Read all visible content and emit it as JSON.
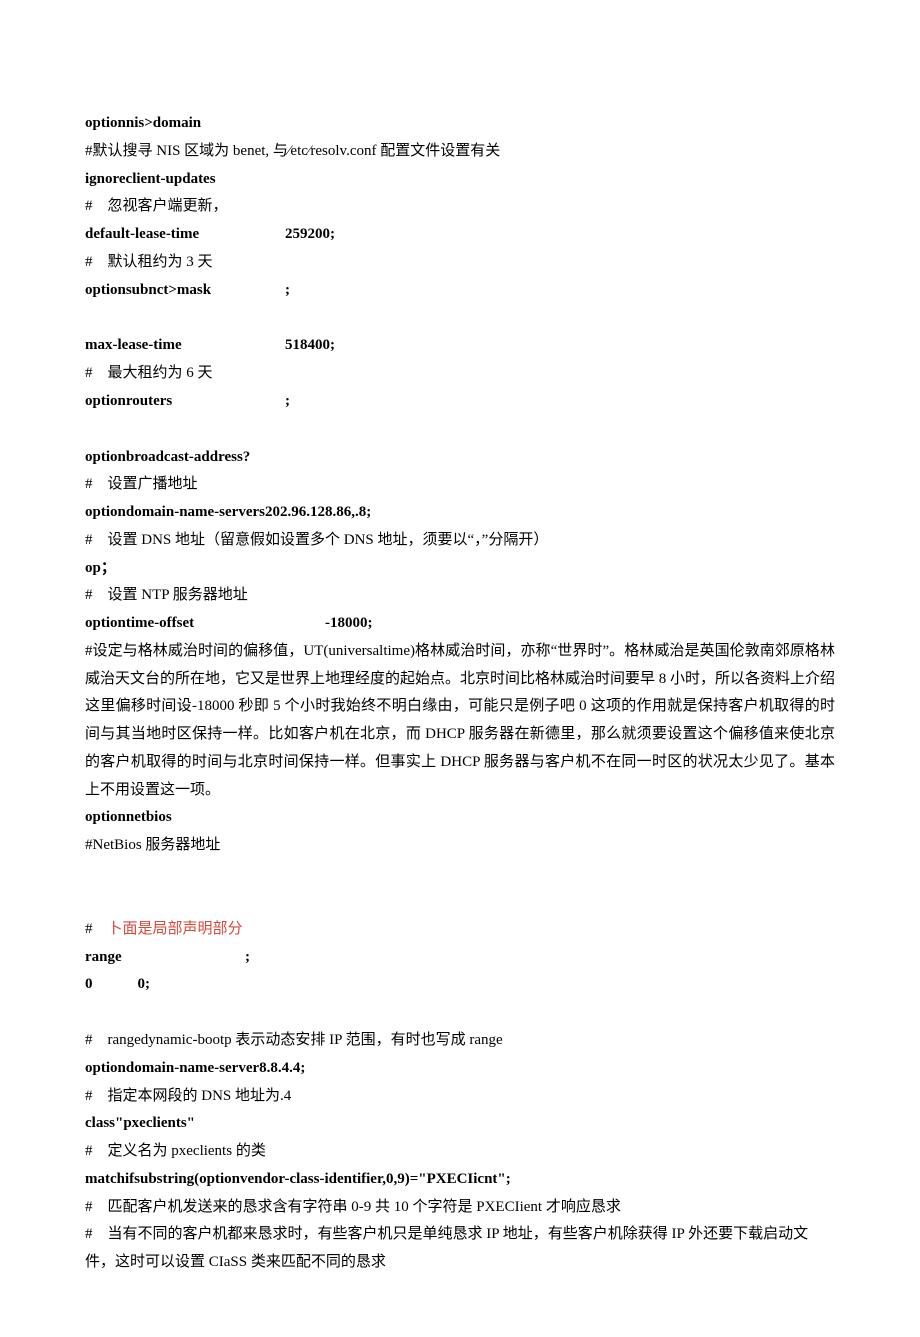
{
  "l01": "optionnis>domain",
  "l02": "#默认搜寻 NIS 区域为 benet, 与⁄etc⁄resolv.conf 配置文件设置有关",
  "l03": "ignoreclient-updates",
  "l04": "#　忽视客户端更新，",
  "l05_left": "default-lease-time",
  "l05_right": "259200;",
  "l06": "#　默认租约为 3 天",
  "l07_left": "optionsubnct>mask",
  "l07_right": ";",
  "l08_left": "max-lease-time",
  "l08_right": "518400;",
  "l09": "#　最大租约为 6 天",
  "l10_left": "optionrouters",
  "l10_right": ";",
  "l11": "optionbroadcast-address?",
  "l12": "#　设置广播地址",
  "l13": "optiondomain-name-servers202.96.128.86,.8;",
  "l14": "#　设置 DNS 地址（留意假如设置多个 DNS 地址，须要以“，”分隔开）",
  "l15": "op；",
  "l16": "#　设置 NTP 服务器地址",
  "l17_left": "optiontime-offset",
  "l17_right": "-18000;",
  "l18": "#设定与格林威治时间的偏移值，UT(universaltime)格林威治时间，亦称“世界时”。格林威治是英国伦敦南郊原格林威治天文台的所在地，它又是世界上地理经度的起始点。北京时间比格林威治时间要早 8 小时，所以各资料上介绍这里偏移时间设-18000 秒即 5 个小时我始终不明白缘由，可能只是例子吧 0 这项的作用就是保持客户机取得的时间与其当地时区保持一样。比如客户机在北京，而 DHCP 服务器在新德里，那么就须要设置这个偏移值来使北京的客户机取得的时间与北京时间保持一样。但事实上 DHCP 服务器与客户机不在同一时区的状况太少见了。基本上不用设置这一项。",
  "l19": "optionnetbios",
  "l20": "#NetBios 服务器地址",
  "l21_hash": "#　",
  "l21_red": "卜面是局部声明部分",
  "l22_left": "range",
  "l22_right": ";",
  "l23": "0　　　0;",
  "l24": "#　rangedynamic-bootp 表示动态安排 IP 范围，有时也写成 range",
  "l25": "optiondomain-name-server8.8.4.4;",
  "l26": "#　指定本网段的 DNS 地址为.4",
  "l27": "class\"pxeclients\"",
  "l28": "#　定义名为 pxeclients 的类",
  "l29": "matchifsubstring(optionvendor-class-identifier,0,9)=\"PXECIicnt\";",
  "l30": "#　匹配客户机发送来的恳求含有字符串 0-9 共 10 个字符是 PXECIient 才响应恳求",
  "l31": "#　当有不同的客户机都来恳求时，有些客户机只是单纯恳求 IP 地址，有些客户机除获得 IP 外还要下载启动文件，这时可以设置 CIaSS 类来匹配不同的恳求"
}
